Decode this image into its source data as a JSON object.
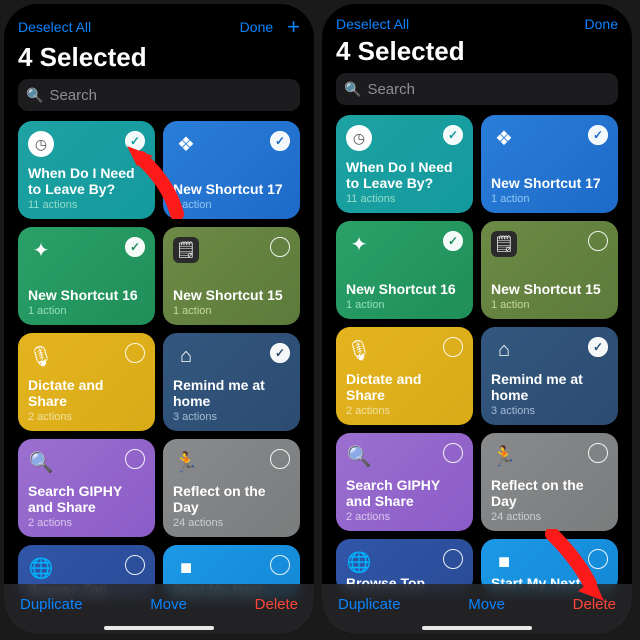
{
  "header": {
    "deselect": "Deselect All",
    "done": "Done",
    "title": "4 Selected"
  },
  "search": {
    "placeholder": "Search"
  },
  "toolbar": {
    "duplicate": "Duplicate",
    "move": "Move",
    "delete": "Delete"
  },
  "left": {
    "selected": [
      "c0",
      "c1",
      "c2",
      "c5"
    ],
    "arrow_target": "card-when-leave"
  },
  "right": {
    "selected": [
      "c0",
      "c1",
      "c2",
      "c5"
    ],
    "arrow_target": "delete-button"
  },
  "cards": [
    {
      "id": "c0",
      "name": "When Do I Need to Leave By?",
      "sub": "11 actions",
      "color": "teal",
      "icon": "clock"
    },
    {
      "id": "c1",
      "name": "New Shortcut 17",
      "sub": "1 action",
      "color": "blue",
      "icon": "layers"
    },
    {
      "id": "c2",
      "name": "New Shortcut 16",
      "sub": "1 action",
      "color": "green",
      "icon": "sparkles"
    },
    {
      "id": "c3",
      "name": "New Shortcut 15",
      "sub": "1 action",
      "color": "olive",
      "icon": "calculator"
    },
    {
      "id": "c4",
      "name": "Dictate and Share",
      "sub": "2 actions",
      "color": "gold",
      "icon": "mic"
    },
    {
      "id": "c5",
      "name": "Remind me at home",
      "sub": "3 actions",
      "color": "navy",
      "icon": "home"
    },
    {
      "id": "c6",
      "name": "Search GIPHY and Share",
      "sub": "2 actions",
      "color": "purple",
      "icon": "search"
    },
    {
      "id": "c7",
      "name": "Reflect on the Day",
      "sub": "24 actions",
      "color": "gray",
      "icon": "run"
    },
    {
      "id": "c8",
      "name": "Browse Top News",
      "sub": "",
      "color": "indigo",
      "icon": "globe"
    },
    {
      "id": "c9",
      "name": "Start My Next Meeting",
      "sub": "",
      "color": "sky",
      "icon": "video"
    }
  ],
  "icons": {
    "clock": "◷",
    "layers": "❖",
    "sparkles": "✦",
    "calculator": "🗒",
    "mic": "🎙",
    "home": "⌂",
    "search": "🔍",
    "run": "🏃",
    "globe": "🌐",
    "video": "■"
  }
}
